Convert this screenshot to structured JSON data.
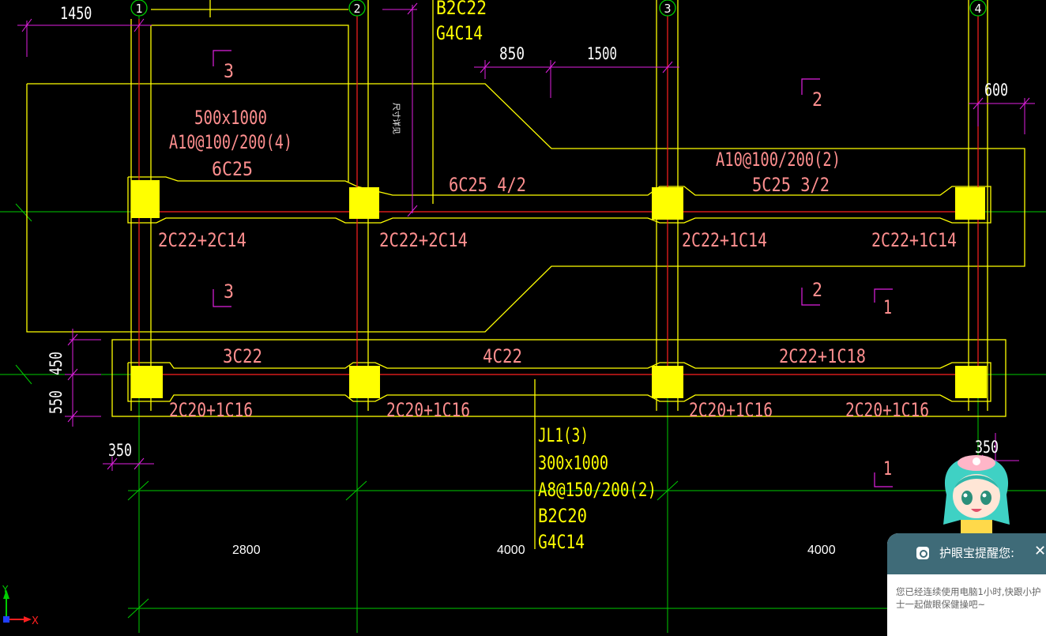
{
  "colors": {
    "background": "#000000",
    "beam": "#ffff00",
    "column": "#ffff00",
    "axis_red": "#ff2020",
    "grid_green": "#00cc00",
    "dim_magenta": "#e020e0",
    "rebar_text": "#ff8f8f",
    "popup_header": "#3f6b78"
  },
  "grid_axes": [
    "1",
    "2",
    "3",
    "4"
  ],
  "dimensions": {
    "top_1450": "1450",
    "d850": "850",
    "d1500": "1500",
    "d600": "600",
    "d450": "450",
    "d550": "550",
    "d350": "350",
    "d350b": "350",
    "span1": "2800",
    "span2": "4000",
    "span3": "4000"
  },
  "upper_beam": {
    "size": "500x1000",
    "stirrup_left": "A10@100/200(4)",
    "top_left": "6C25",
    "top_mid": "6C25 4/2",
    "stirrup_right": "A10@100/200(2)",
    "top_right": "5C25 3/2",
    "bottom": [
      "2C22+2C14",
      "2C22+2C14",
      "2C22+1C14",
      "2C22+1C14"
    ]
  },
  "lower_beam": {
    "top": [
      "3C22",
      "4C22",
      "2C22+1C18"
    ],
    "bottom": [
      "2C20+1C16",
      "2C20+1C16",
      "2C20+1C16",
      "2C20+1C16"
    ]
  },
  "jl1_label": [
    "JL1(3)",
    "300x1000",
    "A8@150/200(2)",
    "B2C20",
    "G4C14"
  ],
  "top_label": [
    "B2C22",
    "G4C14"
  ],
  "section_marks": [
    "3",
    "3",
    "2",
    "2",
    "1",
    "1"
  ],
  "vertical_note": "尺寸详见",
  "ucs": {
    "x": "X",
    "y": "Y"
  },
  "popup": {
    "title": "护眼宝提醒您:",
    "close": "✕",
    "line1": "您已经连续使用电脑1小时,快跟小护",
    "line2": "士一起做眼保健操吧~"
  }
}
